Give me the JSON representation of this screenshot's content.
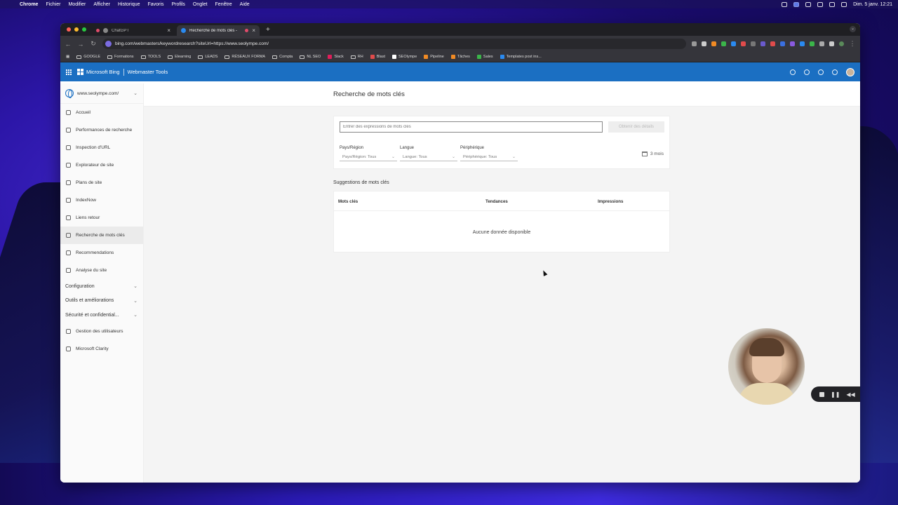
{
  "menubar": {
    "app": "Chrome",
    "items": [
      "Fichier",
      "Modifier",
      "Afficher",
      "Historique",
      "Favoris",
      "Profils",
      "Onglet",
      "Fenêtre",
      "Aide"
    ],
    "clock": "Dim. 5 janv.  12:21"
  },
  "browser": {
    "tabs": [
      {
        "title": "ChatGPT"
      },
      {
        "title": "Recherche de mots clés -"
      }
    ],
    "new_tab": "+",
    "url": "bing.com/webmasters/keywordresearch?siteUrl=https://www.seolympe.com/",
    "bookmarks": [
      "GOOGLE",
      "Formations",
      "TOOLS",
      "Elearning",
      "LEADS",
      "RÉSEAUX FORMA",
      "Compta",
      "NL SEO",
      "Slack",
      "RH",
      "Blast",
      "SEOlympe",
      "Pipeline",
      "Tâches",
      "Sales",
      "Templates post ins..."
    ]
  },
  "header": {
    "brand": "Microsoft Bing",
    "product": "Webmaster Tools"
  },
  "sidebar": {
    "site": "www.seolympe.com/",
    "items": [
      {
        "label": "Accueil"
      },
      {
        "label": "Performances de recherche"
      },
      {
        "label": "Inspection d'URL"
      },
      {
        "label": "Explorateur de site"
      },
      {
        "label": "Plans de site"
      },
      {
        "label": "IndexNow"
      },
      {
        "label": "Liens retour"
      },
      {
        "label": "Recherche de mots clés"
      },
      {
        "label": "Recommendations"
      },
      {
        "label": "Analyse du site"
      }
    ],
    "groups": [
      {
        "label": "Configuration"
      },
      {
        "label": "Outils et améliorations"
      },
      {
        "label": "Sécurité et confidential..."
      }
    ],
    "bottom_items": [
      {
        "label": "Gestion des utilisateurs"
      },
      {
        "label": "Microsoft Clarity"
      }
    ]
  },
  "main": {
    "title": "Recherche de mots clés",
    "search": {
      "placeholder": "Entrer des expressions de mots clés",
      "button": "Obtenir des détails"
    },
    "filters": [
      {
        "label": "Pays/Région",
        "value": "Pays/Région: Tous"
      },
      {
        "label": "Langue",
        "value": "Langue: Tous"
      },
      {
        "label": "Périphérique",
        "value": "Périphérique: Tous"
      }
    ],
    "period": "3 mois",
    "suggestions_title": "Suggestions de mots clés",
    "columns": [
      "Mots clés",
      "Tendances",
      "Impressions"
    ],
    "empty_message": "Aucune donnée disponible"
  },
  "colors": {
    "bing_blue": "#1b6fc2",
    "sidebar_bg": "#fafafa",
    "page_bg": "#f4f4f4"
  }
}
